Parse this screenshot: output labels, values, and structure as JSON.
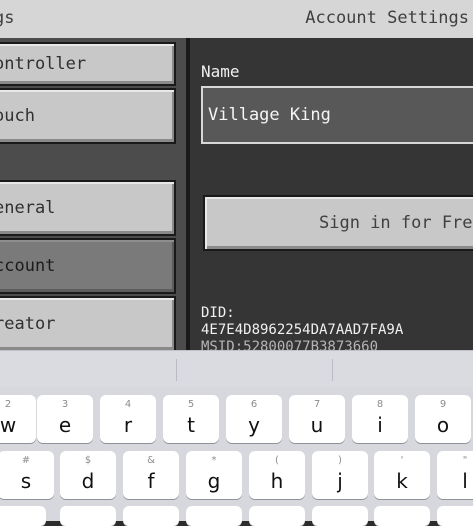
{
  "header": {
    "back_label": "gs",
    "title": "Account Settings"
  },
  "menu": {
    "items": [
      {
        "label": "ontroller",
        "selected": false
      },
      {
        "label": "ouch",
        "selected": false
      },
      {
        "label": "eneral",
        "selected": false
      },
      {
        "label": "ccount",
        "selected": true
      },
      {
        "label": "reator",
        "selected": false
      }
    ]
  },
  "account": {
    "name_label": "Name",
    "name_value": "Village King",
    "signin_label": "Sign in for Free",
    "did_label": "DID:",
    "did_value": "4E7E4D8962254DA7AAD7FA9A",
    "msid_value": "MSID:52800077B3873660"
  },
  "keyboard": {
    "row1": [
      {
        "hint": "2",
        "key": "w"
      },
      {
        "hint": "3",
        "key": "e"
      },
      {
        "hint": "4",
        "key": "r"
      },
      {
        "hint": "5",
        "key": "t"
      },
      {
        "hint": "6",
        "key": "y"
      },
      {
        "hint": "7",
        "key": "u"
      },
      {
        "hint": "8",
        "key": "i"
      },
      {
        "hint": "9",
        "key": "o"
      }
    ],
    "row2": [
      {
        "hint": "#",
        "key": "s"
      },
      {
        "hint": "$",
        "key": "d"
      },
      {
        "hint": "&",
        "key": "f"
      },
      {
        "hint": "*",
        "key": "g"
      },
      {
        "hint": "(",
        "key": "h"
      },
      {
        "hint": ")",
        "key": "j"
      },
      {
        "hint": "'",
        "key": "k"
      },
      {
        "hint": "\"",
        "key": "l"
      }
    ]
  }
}
